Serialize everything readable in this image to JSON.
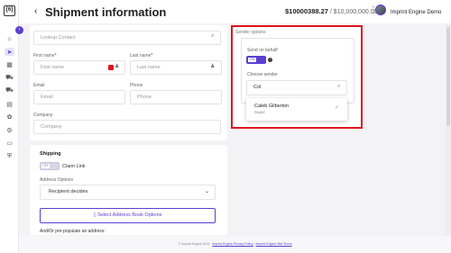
{
  "app": {
    "logo": "[6]"
  },
  "header": {
    "title": "Shipment information",
    "balance_main": "$10000388.27",
    "balance_limit": "/ $10,000,000.00",
    "user_name": "Imprint Engine Demo"
  },
  "sidebar": {
    "icons": [
      "home-icon",
      "send-icon",
      "boxes-icon",
      "truck-icon",
      "truck-fast-icon",
      "clipboard-icon",
      "gift-icon",
      "settings-icon",
      "reports-icon",
      "shield-icon"
    ]
  },
  "contact": {
    "lookup_placeholder": "Lookup Contact",
    "first_name_label": "First name",
    "first_name_placeholder": "First name",
    "last_name_label": "Last name",
    "last_name_placeholder": "Last name",
    "email_label": "Email",
    "email_placeholder": "Email",
    "phone_label": "Phone",
    "phone_placeholder": "Phone",
    "company_label": "Company",
    "company_placeholder": "Company"
  },
  "shipping": {
    "heading": "Shipping",
    "claim_toggle_text": "OFF",
    "claim_label": "Claim Link",
    "address_options_label": "Address Options",
    "address_selected": "Recipient decides",
    "address_book_button": "Select Address Book Options",
    "prepopulate_text": "And/Or pre-populate an address:"
  },
  "sender": {
    "heading": "Sender options",
    "send_on_behalf_label": "Send on behalf",
    "toggle_text": "ON",
    "choose_sender_label": "Choose sender",
    "search_value": "Col",
    "option_name": "Caleb Gilberton",
    "option_role": "Super"
  },
  "footer": {
    "copyright": "© Imprint Engine 2024 ·",
    "privacy": "Imprint Engine Privacy Policy",
    "sep": " | ",
    "terms": "Imprint Engine Site Terms"
  },
  "colors": {
    "accent": "#5a3fd1",
    "highlight": "#e0141e"
  }
}
